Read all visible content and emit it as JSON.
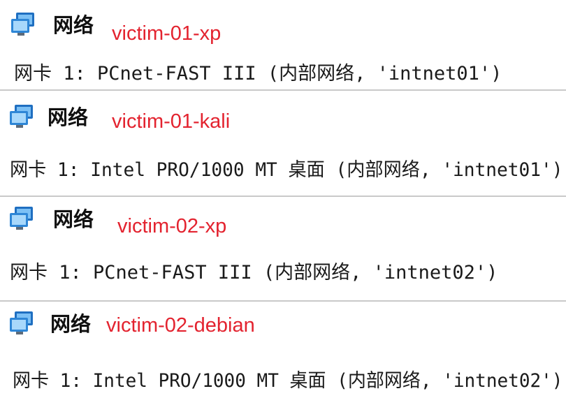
{
  "sections": [
    {
      "title": "网络",
      "vm_name": "victim-01-xp",
      "adapter": "网卡 1: PCnet-FAST III (内部网络, 'intnet01')",
      "icon": "network-monitor-icon"
    },
    {
      "title": "网络",
      "vm_name": "victim-01-kali",
      "adapter": "网卡 1: Intel PRO/1000 MT 桌面 (内部网络, 'intnet01')",
      "icon": "network-monitor-icon"
    },
    {
      "title": "网络",
      "vm_name": "victim-02-xp",
      "adapter": "网卡 1: PCnet-FAST III (内部网络, 'intnet02')",
      "icon": "network-monitor-icon"
    },
    {
      "title": "网络",
      "vm_name": "victim-02-debian",
      "adapter": "网卡 1: Intel PRO/1000 MT 桌面 (内部网络, 'intnet02')",
      "icon": "network-monitor-icon"
    }
  ],
  "colors": {
    "vm_name": "#e3232f",
    "separator": "#c9c9c9",
    "icon_blue": "#2e86d6"
  }
}
